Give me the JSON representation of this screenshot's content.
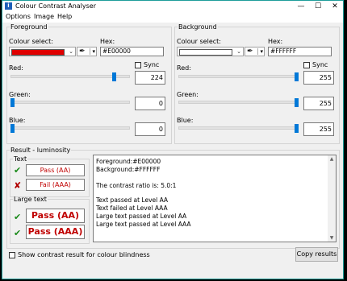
{
  "window": {
    "title": "Colour Contrast Analyser",
    "icon_letter": "i"
  },
  "menu": [
    "Options",
    "Image",
    "Help"
  ],
  "foreground": {
    "legend": "Foreground",
    "colour_select_label": "Colour select:",
    "hex_label": "Hex:",
    "hex_value": "#E00000",
    "swatch_color": "#e00000",
    "sync_label": "Sync",
    "red_label": "Red:",
    "red_value": "224",
    "red_level": 0.878,
    "green_label": "Green:",
    "green_value": "0",
    "green_level": 0,
    "blue_label": "Blue:",
    "blue_value": "0",
    "blue_level": 0
  },
  "background": {
    "legend": "Background",
    "colour_select_label": "Colour select:",
    "hex_label": "Hex:",
    "hex_value": "#FFFFFF",
    "swatch_color": "#ffffff",
    "sync_label": "Sync",
    "red_label": "Red:",
    "red_value": "255",
    "red_level": 1,
    "green_label": "Green:",
    "green_value": "255",
    "green_level": 1,
    "blue_label": "Blue:",
    "blue_value": "255",
    "blue_level": 1
  },
  "result": {
    "legend": "Result - luminosity",
    "text_legend": "Text",
    "large_text_legend": "Large text",
    "pass_aa": "Pass (AA)",
    "fail_aaa": "Fail (AAA)",
    "large_pass_aa": "Pass (AA)",
    "large_pass_aaa": "Pass (AAA)",
    "report_lines": [
      "Foreground:#E00000",
      "Background:#FFFFFF",
      "",
      "The contrast ratio is: 5.0:1",
      "",
      "Text passed at Level AA",
      "Text failed at Level AAA",
      "Large text passed at Level AA",
      "Large text passed at Level AAA"
    ]
  },
  "bottom": {
    "blindness_label": "Show contrast result for colour blindness",
    "copy_button": "Copy results"
  }
}
